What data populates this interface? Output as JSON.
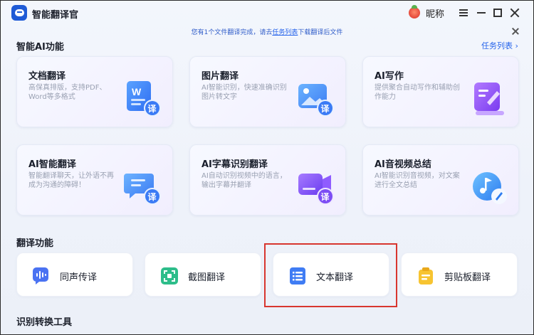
{
  "app": {
    "title": "智能翻译官",
    "nickname": "昵称"
  },
  "notice": {
    "prefix": "您有1个文件翻译完成，请去",
    "link": "任务列表",
    "suffix": "下载翻译后文件"
  },
  "sections": {
    "ai_title": "智能AI功能",
    "task_list": "任务列表 ›",
    "translate_title": "翻译功能",
    "tools_title": "识别转换工具"
  },
  "ai_cards": [
    {
      "title": "文档翻译",
      "desc": "高保真排版，支持PDF、Word等多格式",
      "icon": "word-translate-icon"
    },
    {
      "title": "图片翻译",
      "desc": "AI智能识别，快速准确识别图片转文字",
      "icon": "image-translate-icon"
    },
    {
      "title": "AI写作",
      "desc": "提供聚合自动写作和辅助创作能力",
      "icon": "ai-writing-icon"
    },
    {
      "title": "AI智能翻译",
      "desc": "智能翻译聊天，让外语不再成为沟通的障碍！",
      "icon": "chat-translate-icon"
    },
    {
      "title": "AI字幕识别翻译",
      "desc": "AI自动识别视频中的语言，输出字幕并翻译",
      "icon": "video-subtitle-icon"
    },
    {
      "title": "AI音视频总结",
      "desc": "AI智能识别音视频，对文案进行全文总结",
      "icon": "music-summary-icon"
    }
  ],
  "icon_badge": "译",
  "features": [
    {
      "label": "同声传译",
      "icon": "voice-wave-icon"
    },
    {
      "label": "截图翻译",
      "icon": "screenshot-icon"
    },
    {
      "label": "文本翻译",
      "icon": "text-doc-icon"
    },
    {
      "label": "剪贴板翻译",
      "icon": "clipboard-icon"
    }
  ],
  "colors": {
    "accent": "#2563eb",
    "highlight_border": "#d8362f"
  }
}
